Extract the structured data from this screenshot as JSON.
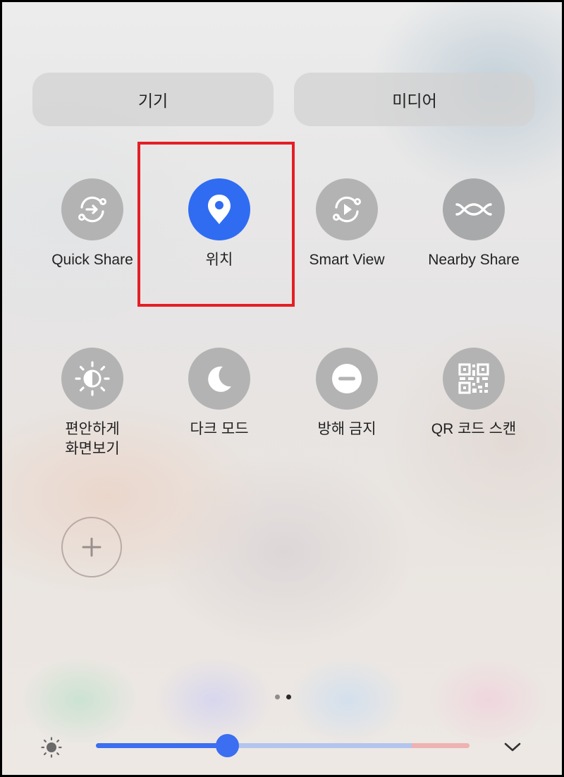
{
  "tabs": [
    {
      "label": "기기"
    },
    {
      "label": "미디어"
    }
  ],
  "tiles_row1": [
    {
      "label": "Quick Share",
      "icon": "quick-share-icon",
      "active": false
    },
    {
      "label": "위치",
      "icon": "location-pin-icon",
      "active": true
    },
    {
      "label": "Smart View",
      "icon": "smart-view-icon",
      "active": false
    },
    {
      "label": "Nearby Share",
      "icon": "nearby-share-icon",
      "active": false
    }
  ],
  "tiles_row2": [
    {
      "label": "편안하게\n화면보기",
      "icon": "eye-comfort-icon",
      "active": false
    },
    {
      "label": "다크 모드",
      "icon": "dark-mode-moon-icon",
      "active": false
    },
    {
      "label": "방해 금지",
      "icon": "do-not-disturb-icon",
      "active": false
    },
    {
      "label": "QR 코드 스캔",
      "icon": "qr-code-icon",
      "active": false
    }
  ],
  "add_tile": {
    "icon": "plus-icon"
  },
  "page_indicator": {
    "count": 2,
    "current": 2
  },
  "brightness": {
    "icon": "sun-icon",
    "level": 0.35,
    "expand_icon": "chevron-down-icon"
  },
  "colors": {
    "active_tile": "#2f6cf2",
    "inactive_tile": "#b4b3b3",
    "highlight_box": "#e41e25",
    "slider_active": "#3b6ef0",
    "slider_inactive": "#b3c5ee",
    "slider_warm": "#eeb2b2"
  }
}
